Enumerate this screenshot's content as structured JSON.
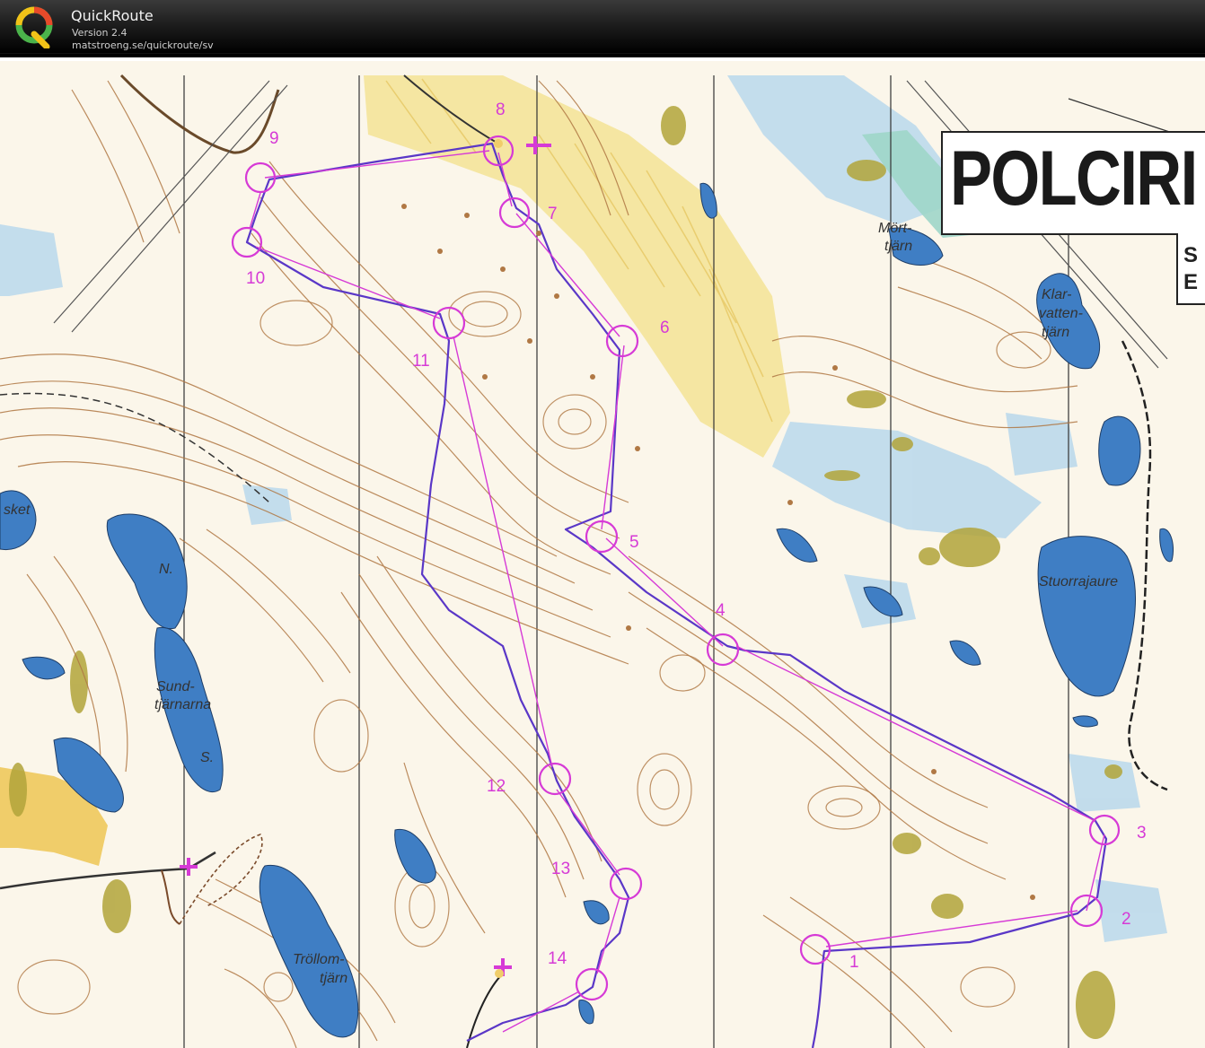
{
  "app": {
    "title": "QuickRoute",
    "version": "Version 2.4",
    "url": "matstroeng.se/quickroute/sv"
  },
  "map": {
    "sign_text": "POLCIRI",
    "sign2_lines": [
      "S",
      "E"
    ],
    "controls": [
      {
        "id": "c1",
        "label": "1"
      },
      {
        "id": "c2",
        "label": "2"
      },
      {
        "id": "c3",
        "label": "3"
      },
      {
        "id": "c4",
        "label": "4"
      },
      {
        "id": "c5",
        "label": "5"
      },
      {
        "id": "c6",
        "label": "6"
      },
      {
        "id": "c7",
        "label": "7"
      },
      {
        "id": "c8",
        "label": "8"
      },
      {
        "id": "c9",
        "label": "9"
      },
      {
        "id": "c10",
        "label": "10"
      },
      {
        "id": "c11",
        "label": "11"
      },
      {
        "id": "c12",
        "label": "12"
      },
      {
        "id": "c13",
        "label": "13"
      },
      {
        "id": "c14",
        "label": "14"
      }
    ],
    "place_names": {
      "mort": "Mört-",
      "mort2": "tjärn",
      "klar1": "Klar-",
      "klar2": "vatten-",
      "klar3": "tjärn",
      "stuorra": "Stuorrajaure",
      "sket": "sket",
      "n": "N.",
      "sund1": "Sund-",
      "sund2": "tjärnarna",
      "s": "S.",
      "troll1": "Tröllom-",
      "troll2": "tjärn"
    },
    "colors": {
      "paper": "#fbf6ea",
      "contour": "#b07844",
      "water": "#3f7ec4",
      "marsh": "#a8cde6",
      "yellow": "#f1d17a",
      "olive": "#b2a43a",
      "course": "#d63ad6",
      "route": "#5a37c7"
    }
  }
}
